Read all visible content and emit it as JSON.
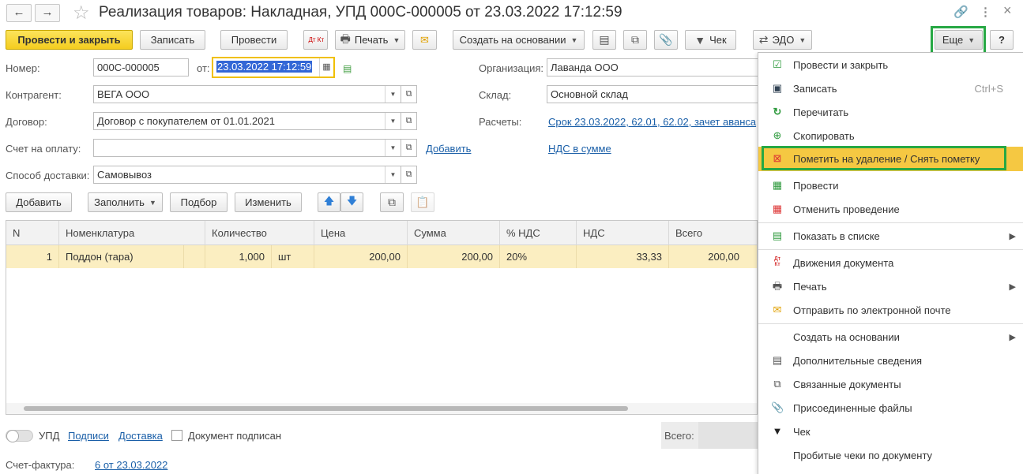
{
  "window": {
    "title": "Реализация товаров: Накладная, УПД 000С-000005 от 23.03.2022 17:12:59",
    "back_icon": "←",
    "forward_icon": "→",
    "star_icon": "☆",
    "link_icon": "🔗",
    "more_icon": "⋮",
    "close_icon": "×"
  },
  "toolbar": {
    "post_close": "Провести и закрыть",
    "save": "Записать",
    "post": "Провести",
    "dtkt": "Дт Кт",
    "print": "Печать",
    "create_based": "Создать на основании",
    "check": "Чек",
    "edo": "ЭДО",
    "more": "Еще",
    "help": "?"
  },
  "form": {
    "number_label": "Номер:",
    "number_value": "000С-000005",
    "date_label": "от:",
    "date_value": "23.03.2022 17:12:59",
    "org_label": "Организация:",
    "org_value": "Лаванда ООО",
    "counterparty_label": "Контрагент:",
    "counterparty_value": "ВЕГА ООО",
    "warehouse_label": "Склад:",
    "warehouse_value": "Основной склад",
    "contract_label": "Договор:",
    "contract_value": "Договор с покупателем от 01.01.2021",
    "settlements_label": "Расчеты:",
    "settlements_link": "Срок 23.03.2022, 62.01, 62.02, зачет аванса",
    "invoice_label": "Счет на оплату:",
    "invoice_value": "",
    "add_link": "Добавить",
    "vat_link": "НДС в сумме",
    "delivery_label": "Способ доставки:",
    "delivery_value": "Самовывоз"
  },
  "table_toolbar": {
    "add": "Добавить",
    "fill": "Заполнить",
    "pick": "Подбор",
    "change": "Изменить"
  },
  "table": {
    "headers": [
      "N",
      "Номенклатура",
      "Количество",
      "Цена",
      "Сумма",
      "% НДС",
      "НДС",
      "Всего"
    ],
    "rows": [
      {
        "n": "1",
        "item": "Поддон (тара)",
        "qty": "1,000",
        "unit": "шт",
        "price": "200,00",
        "sum": "200,00",
        "vat_rate": "20%",
        "vat": "33,33",
        "total": "200,00"
      }
    ]
  },
  "footer": {
    "upd_label": "УПД",
    "signatures_link": "Подписи",
    "delivery_link": "Доставка",
    "signed_label": "Документ подписан",
    "total_label": "Всего:",
    "invoice_label": "Счет-фактура:",
    "invoice_link": "6 от 23.03.2022"
  },
  "menu": {
    "items": [
      {
        "label": "Провести и закрыть",
        "shortcut": "",
        "icon": "post-close-icon"
      },
      {
        "label": "Записать",
        "shortcut": "Ctrl+S",
        "icon": "save-icon"
      },
      {
        "label": "Перечитать",
        "shortcut": "",
        "icon": "reread-icon"
      },
      {
        "label": "Скопировать",
        "shortcut": "",
        "icon": "copy-icon"
      },
      {
        "label": "Пометить на удаление / Снять пометку",
        "shortcut": "",
        "icon": "delete-mark-icon"
      },
      {
        "label": "Провести",
        "shortcut": "",
        "icon": "post-icon"
      },
      {
        "label": "Отменить проведение",
        "shortcut": "",
        "icon": "unpost-icon"
      },
      {
        "label": "Показать в списке",
        "shortcut": "",
        "icon": "show-in-list-icon"
      },
      {
        "label": "Движения документа",
        "shortcut": "",
        "icon": "dtkt-icon"
      },
      {
        "label": "Печать",
        "shortcut": "",
        "icon": "print-icon"
      },
      {
        "label": "Отправить по электронной почте",
        "shortcut": "",
        "icon": "email-icon"
      },
      {
        "label": "Создать на основании",
        "shortcut": "",
        "icon": ""
      },
      {
        "label": "Дополнительные сведения",
        "shortcut": "",
        "icon": "details-icon"
      },
      {
        "label": "Связанные документы",
        "shortcut": "",
        "icon": "related-docs-icon"
      },
      {
        "label": "Присоединенные файлы",
        "shortcut": "",
        "icon": "paperclip-icon"
      },
      {
        "label": "Чек",
        "shortcut": "",
        "icon": "receipt-icon"
      },
      {
        "label": "Пробитые чеки по документу",
        "shortcut": "",
        "icon": ""
      }
    ]
  },
  "colors": {
    "accent_yellow": "#f4cd1f",
    "highlight_row": "#fbeec1",
    "menu_highlight": "#f5c842",
    "annotation_green": "#27a844",
    "link_blue": "#1a5fa8"
  }
}
